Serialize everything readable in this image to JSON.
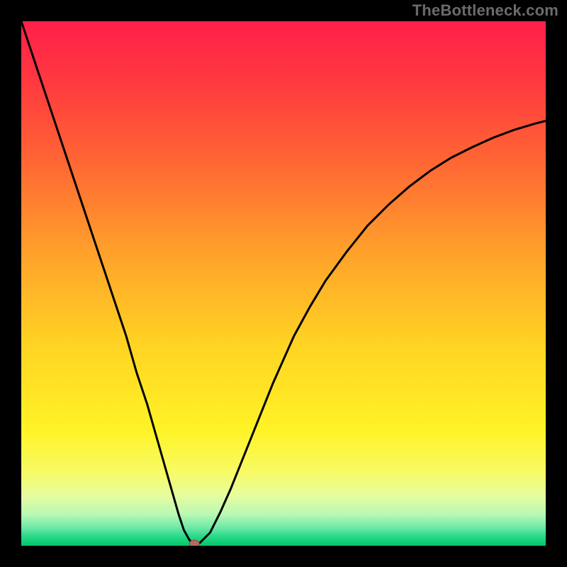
{
  "watermark": "TheBottleneck.com",
  "colors": {
    "black": "#000000",
    "curve": "#000000",
    "marker_fill": "#b86a5a",
    "marker_stroke": "#8a4a3f",
    "gradient_stops": [
      {
        "offset": 0.0,
        "color": "#ff1f4a"
      },
      {
        "offset": 0.12,
        "color": "#ff3a3f"
      },
      {
        "offset": 0.28,
        "color": "#ff6a33"
      },
      {
        "offset": 0.45,
        "color": "#ffa42a"
      },
      {
        "offset": 0.62,
        "color": "#ffd423"
      },
      {
        "offset": 0.78,
        "color": "#fff326"
      },
      {
        "offset": 0.86,
        "color": "#f7fb65"
      },
      {
        "offset": 0.905,
        "color": "#e6fca0"
      },
      {
        "offset": 0.94,
        "color": "#b9f9b4"
      },
      {
        "offset": 0.965,
        "color": "#6fe9a8"
      },
      {
        "offset": 0.982,
        "color": "#2ad98a"
      },
      {
        "offset": 1.0,
        "color": "#00c769"
      }
    ]
  },
  "chart_data": {
    "type": "line",
    "title": "",
    "xlabel": "",
    "ylabel": "",
    "xlim": [
      0,
      100
    ],
    "ylim": [
      0,
      100
    ],
    "marker": {
      "x": 33,
      "y": 0
    },
    "series": [
      {
        "name": "curve",
        "x": [
          0,
          2,
          4,
          6,
          8,
          10,
          12,
          14,
          16,
          18,
          20,
          22,
          24,
          26,
          28,
          30,
          31,
          32,
          33,
          34,
          36,
          38,
          40,
          42,
          44,
          46,
          48,
          50,
          52,
          55,
          58,
          62,
          66,
          70,
          74,
          78,
          82,
          86,
          90,
          94,
          98,
          100
        ],
        "y": [
          100,
          94,
          88,
          82,
          76,
          70,
          64,
          58,
          52,
          46,
          40,
          33,
          27,
          20,
          13,
          6,
          3.0,
          1.2,
          0.0,
          0.5,
          2.5,
          6.5,
          11,
          16,
          21,
          26,
          31,
          35.5,
          40,
          45.5,
          50.5,
          56,
          61,
          65,
          68.5,
          71.5,
          74,
          76,
          77.8,
          79.3,
          80.5,
          81
        ]
      }
    ]
  }
}
